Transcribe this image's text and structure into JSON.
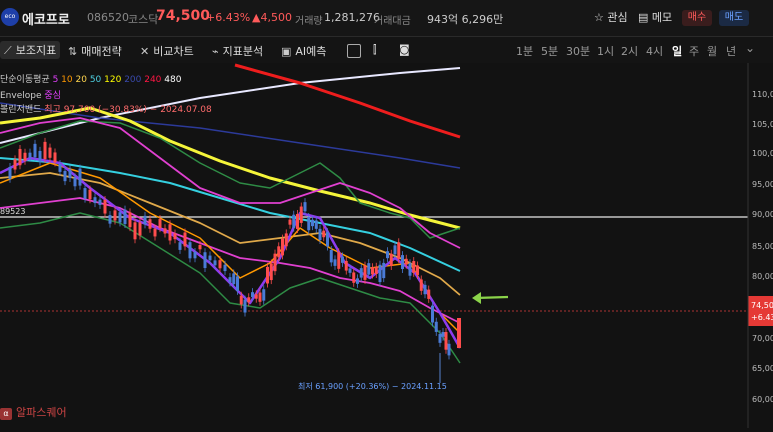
{
  "header": {
    "logo_text": "eco",
    "name": "에코프로",
    "code": "086520",
    "market": "코스닥",
    "price": "74,500",
    "change_pct": "+6.43%",
    "change_amt": "▲4,500",
    "volume_label": "거래량",
    "volume": "1,281,276",
    "amount_label": "거래대금",
    "amount": "943억 6,296만",
    "fav_label": "관심",
    "memo_label": "메모",
    "buy_label": "매수",
    "sell_label": "매도"
  },
  "toolbar": {
    "aux_label": "보조지표",
    "trade_label": "매매전략",
    "compare_label": "비교차트",
    "analysis_label": "지표분석",
    "ai_label": "AI예측",
    "timeframes": [
      "1분",
      "5분",
      "30분",
      "1시",
      "2시",
      "4시",
      "일",
      "주",
      "월",
      "년"
    ],
    "active_timeframe": "일"
  },
  "legend": {
    "ma_label": "단순이동평균",
    "ma_periods": [
      {
        "label": "5",
        "color": "#e040fb"
      },
      {
        "label": "10",
        "color": "#ff9800"
      },
      {
        "label": "20",
        "color": "#ffd54f"
      },
      {
        "label": "50",
        "color": "#4dd0e1"
      },
      {
        "label": "120",
        "color": "#ffff00"
      },
      {
        "label": "200",
        "color": "#3949ab"
      },
      {
        "label": "240",
        "color": "#ff1744"
      },
      {
        "label": "480",
        "color": "#ffffff"
      }
    ],
    "envelope_label": "Envelope",
    "envelope_center": "중심",
    "bollinger_label": "볼린저밴드",
    "high_annotation": "최고 97,700 (−30.83%) − 2024.07.08"
  },
  "chart": {
    "y_ticks": [
      "110,00",
      "105,00",
      "100,00",
      "95,00",
      "90,00",
      "85,00",
      "80,00",
      "75,00",
      "70,00",
      "65,00",
      "60,00"
    ],
    "hline_label": "89523",
    "price_tag": "74,50",
    "price_tag_pct": "+6.43",
    "low_annotation": "최저 61,900 (+20.36%) − 2024.11.15"
  },
  "watermark": {
    "icon": "α",
    "text": "알파스퀘어"
  },
  "colors": {
    "up": "#ff4d4d",
    "down": "#4a7bd6",
    "accent": "#ff5a5a"
  }
}
